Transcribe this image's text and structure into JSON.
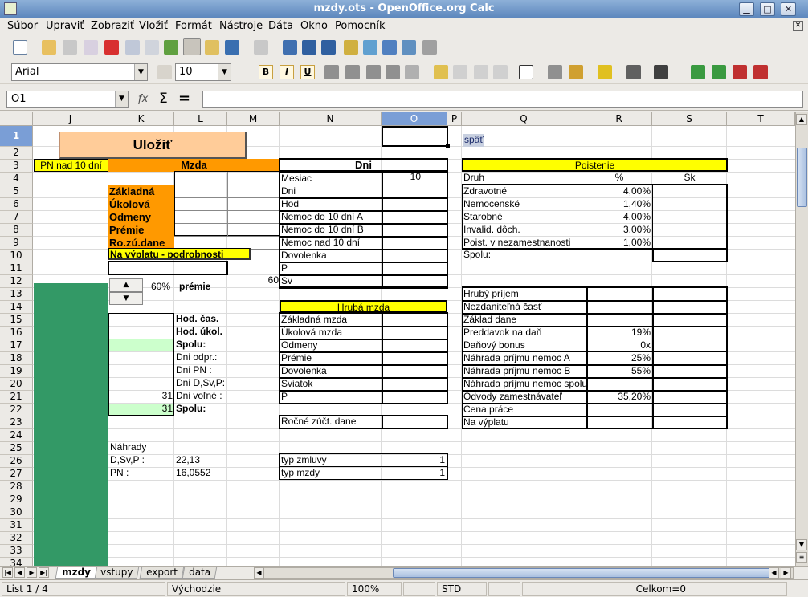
{
  "window": {
    "title": "mzdy.ots - OpenOffice.org Calc"
  },
  "menu": [
    "Súbor",
    "Upraviť",
    "Zobraziť",
    "Vložiť",
    "Formát",
    "Nástroje",
    "Dáta",
    "Okno",
    "Pomocník"
  ],
  "toolbar": {
    "font_name": "Arial",
    "font_size": "10"
  },
  "formula": {
    "cell_ref": "O1",
    "content": ""
  },
  "columns": [
    "J",
    "K",
    "L",
    "M",
    "N",
    "O",
    "P",
    "Q",
    "R",
    "S",
    "T"
  ],
  "rows": [
    "1",
    "2",
    "3",
    "4",
    "5",
    "6",
    "7",
    "8",
    "9",
    "10",
    "11",
    "12",
    "13",
    "14",
    "15",
    "16",
    "17",
    "18",
    "19",
    "20",
    "21",
    "22",
    "23",
    "24",
    "25",
    "26",
    "27",
    "28",
    "29",
    "30",
    "31",
    "32",
    "33",
    "34"
  ],
  "sheet": {
    "ulozit": "Uložiť",
    "spat": "späť",
    "pn_nad": "PN nad 10 dní",
    "mzda_hdr": "Mzda",
    "mzda_items": [
      "Základná",
      "Úkolová",
      "Odmeny",
      "Prémie",
      "Ro.zú.dane"
    ],
    "na_vyplatu_link": "Na výplatu - podrobnosti",
    "premie_pct": "60%",
    "premie_label": "prémie",
    "m12_value": "60",
    "hod_cas": "Hod. čas.",
    "hod_ukol": "Hod. úkol.",
    "spolu1": "Spolu:",
    "dni_odpr": "Dni odpr.:",
    "dni_pn": "Dni PN :",
    "dni_dsvp": "Dni D,Sv,P:",
    "dni_volne": "Dni voľné :",
    "k21": "31",
    "k22": "31",
    "spolu2": "Spolu:",
    "nahrady": "Náhrady",
    "dsvp_label": "D,Sv,P :",
    "dsvp_val": "22,13",
    "pn_label": "PN :",
    "pn_val": "16,0552",
    "dni_hdr": "Dni",
    "dni_rows": [
      "Mesiac",
      "Dni",
      "Hod",
      "Nemoc do 10 dní  A",
      "Nemoc do 10 dní  B",
      "Nemoc nad 10 dní",
      "Dovolenka",
      "P",
      "Sv"
    ],
    "mesiac_val": "10",
    "hruba_hdr": "Hrubá mzda",
    "hruba_rows": [
      "Základná mzda",
      "Úkolová mzda",
      "Odmeny",
      "Prémie",
      "Dovolenka",
      "Sviatok",
      "P"
    ],
    "rocne": "Ročné zúčt. dane",
    "typ_zmluvy": "typ zmluvy",
    "typ_zmluvy_val": "1",
    "typ_mzdy": "typ mzdy",
    "typ_mzdy_val": "1",
    "poistenie_hdr": "Poistenie",
    "druh": "Druh",
    "pct_hdr": "%",
    "sk_hdr": "Sk",
    "poist_rows": [
      {
        "name": "Zdravotné",
        "val": "4,00%"
      },
      {
        "name": "Nemocenské",
        "val": "1,40%"
      },
      {
        "name": "Starobné",
        "val": "4,00%"
      },
      {
        "name": "Invalid. dôch.",
        "val": "3,00%"
      },
      {
        "name": "Poist. v nezamestnanosti",
        "val": "1,00%"
      }
    ],
    "spolu3": "Spolu:",
    "vyplata_rows": [
      {
        "name": "Hrubý príjem",
        "val": ""
      },
      {
        "name": "Nezdaniteľná časť",
        "val": ""
      },
      {
        "name": "Základ  dane",
        "val": ""
      },
      {
        "name": "Preddavok na daň",
        "val": "19%"
      },
      {
        "name": "Daňový bonus",
        "val": "0x"
      },
      {
        "name": "Náhrada príjmu nemoc A",
        "val": "25%"
      },
      {
        "name": "Náhrada príjmu nemoc B",
        "val": "55%"
      },
      {
        "name": "Náhrada príjmu nemoc spolu",
        "val": ""
      },
      {
        "name": "Odvody zamestnávateľ",
        "val": "35,20%"
      },
      {
        "name": "Cena práce",
        "val": ""
      },
      {
        "name": "Na výplatu",
        "val": ""
      }
    ]
  },
  "tabs": [
    "mzdy",
    "vstupy",
    "export",
    "data"
  ],
  "status": {
    "sheet": "List 1 / 4",
    "style": "Východzie",
    "zoom": "100%",
    "mode": "STD",
    "sum": "Celkom=0"
  }
}
